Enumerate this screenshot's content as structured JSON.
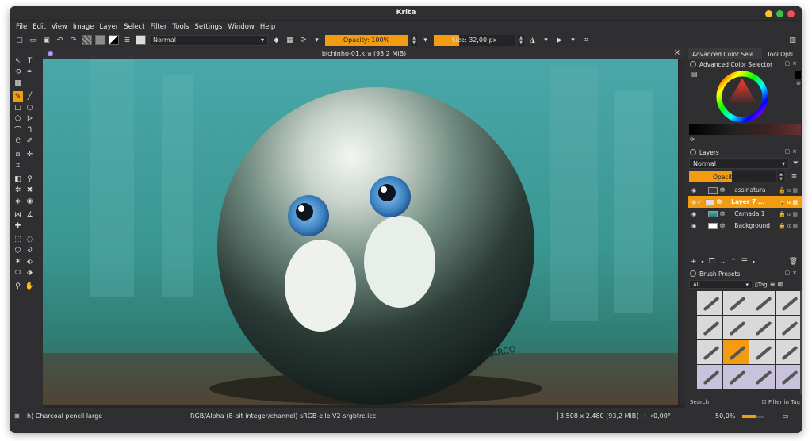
{
  "window": {
    "title": "Krita"
  },
  "menu": [
    "File",
    "Edit",
    "View",
    "Image",
    "Layer",
    "Select",
    "Filter",
    "Tools",
    "Settings",
    "Window",
    "Help"
  ],
  "toolbar": {
    "blend_mode": "Normal",
    "opacity_label": "Opacity: 100%",
    "size_label": "Size: 32,00 px"
  },
  "canvas": {
    "tab_title": "bichinho-01.kra (93,2 MiB)",
    "signature_text": "MARCO"
  },
  "dock": {
    "tabs": [
      "Advanced Color Sele...",
      "Tool Opti..."
    ],
    "color_selector": {
      "title": "Advanced Color Selector"
    },
    "layers": {
      "title": "Layers",
      "blend_mode": "Normal",
      "opacity_label": "Opacity: 49%",
      "opacity_fraction": 0.49,
      "items": [
        {
          "name": "assinatura",
          "selected": false
        },
        {
          "name": "Layer 7 ...",
          "selected": true
        },
        {
          "name": "Camada 1",
          "selected": false
        },
        {
          "name": "Background",
          "selected": false
        }
      ]
    },
    "brush_presets": {
      "title": "Brush Presets",
      "filter_value": "All",
      "tag_label": "Tag",
      "search_placeholder": "Search",
      "filter_in_tag_label": "Filter in Tag"
    }
  },
  "status": {
    "brush_name": "h) Charcoal pencil large",
    "color_model": "RGB/Alpha (8-bit integer/channel)  sRGB-elle-V2-srgbtrc.icc",
    "image_size": "3.508 x 2.480 (93,2 MiB)",
    "rotation": "0,00°",
    "zoom": "50,0%"
  },
  "colors": {
    "accent": "#f39c12",
    "window_bg": "#2f2f31",
    "canvas_teal": "#3b9a97"
  }
}
